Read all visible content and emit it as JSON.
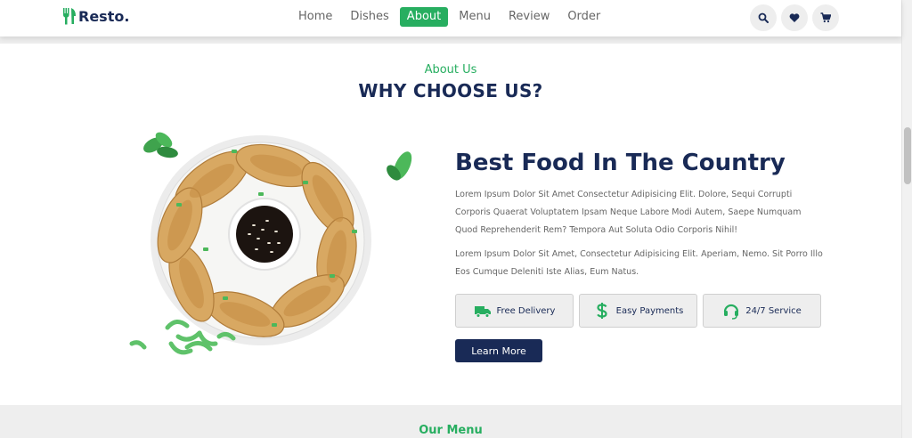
{
  "brand": {
    "name": "Resto."
  },
  "nav": {
    "items": [
      {
        "label": "Home",
        "active": false
      },
      {
        "label": "Dishes",
        "active": false
      },
      {
        "label": "About",
        "active": true
      },
      {
        "label": "Menu",
        "active": false
      },
      {
        "label": "Review",
        "active": false
      },
      {
        "label": "Order",
        "active": false
      }
    ]
  },
  "header_icons": [
    "search-icon",
    "heart-icon",
    "cart-icon"
  ],
  "about": {
    "subheading": "About Us",
    "heading": "WHY CHOOSE US?",
    "title": "Best Food In The Country",
    "paragraph1": "Lorem Ipsum Dolor Sit Amet Consectetur Adipisicing Elit. Dolore, Sequi Corrupti Corporis Quaerat Voluptatem Ipsam Neque Labore Modi Autem, Saepe Numquam Quod Reprehenderit Rem? Tempora Aut Soluta Odio Corporis Nihil!",
    "paragraph2": "Lorem Ipsum Dolor Sit Amet, Consectetur Adipisicing Elit. Aperiam, Nemo. Sit Porro Illo Eos Cumque Deleniti Iste Alias, Eum Natus.",
    "features": [
      {
        "label": "Free Delivery",
        "icon": "truck-icon"
      },
      {
        "label": "Easy Payments",
        "icon": "dollar-icon"
      },
      {
        "label": "24/7 Service",
        "icon": "headset-icon"
      }
    ],
    "button_label": "Learn More"
  },
  "menu_section": {
    "subheading": "Our Menu"
  },
  "colors": {
    "accent": "#27ae60",
    "primary": "#192a56",
    "text": "#666666",
    "band": "#eeeeee"
  }
}
